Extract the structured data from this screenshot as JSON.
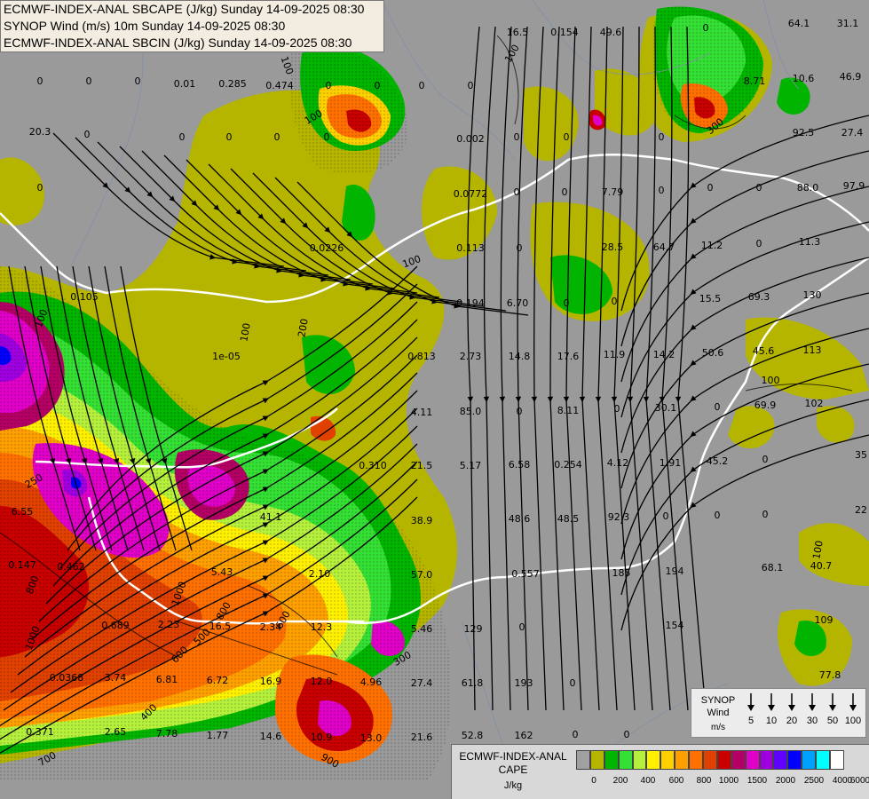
{
  "titles": {
    "line1": "ECMWF-INDEX-ANAL SBCAPE (J/kg) Sunday 14-09-2025 08:30",
    "line2": "SYNOP Wind (m/s) 10m Sunday 14-09-2025 08:30",
    "line3": "ECMWF-INDEX-ANAL SBCIN (J/kg) Sunday 14-09-2025 08:30"
  },
  "cape_legend": {
    "title_line1": "ECMWF-INDEX-ANAL",
    "title_line2": "CAPE",
    "unit": "J/kg",
    "tick_labels": [
      "0",
      "200",
      "400",
      "600",
      "800",
      "1000",
      "1500",
      "2000",
      "2500",
      "4000",
      "6000"
    ],
    "colors": [
      "#a0a0a0",
      "#b5b500",
      "#00b400",
      "#35e035",
      "#b4f03c",
      "#fff000",
      "#ffd000",
      "#ffa000",
      "#ff7000",
      "#e04000",
      "#c80000",
      "#b40064",
      "#e000c8",
      "#a000e0",
      "#6000ff",
      "#0000ff",
      "#00a0ff",
      "#00ffff",
      "#ffffff"
    ]
  },
  "wind_legend": {
    "title_line1": "SYNOP",
    "title_line2": "Wind",
    "unit": "m/s",
    "speeds": [
      "5",
      "10",
      "20",
      "30",
      "50",
      "100"
    ]
  },
  "map_labels": [
    {
      "text": "0"
    },
    {
      "text": "0"
    },
    {
      "text": "0"
    },
    {
      "text": "0.01"
    },
    {
      "text": "0.285"
    },
    {
      "text": "0.474"
    },
    {
      "text": "0"
    },
    {
      "text": "0"
    },
    {
      "text": "0"
    },
    {
      "text": "0"
    },
    {
      "text": "16.5"
    },
    {
      "text": "0.154"
    },
    {
      "text": "49.6"
    },
    {
      "text": "0"
    },
    {
      "text": "64.1"
    },
    {
      "text": "31.1"
    },
    {
      "text": "20.3"
    },
    {
      "text": "0"
    },
    {
      "text": "0"
    },
    {
      "text": "0"
    },
    {
      "text": "0"
    },
    {
      "text": "0"
    },
    {
      "text": "0.002"
    },
    {
      "text": "0"
    },
    {
      "text": "0"
    },
    {
      "text": "0"
    },
    {
      "text": "8.71"
    },
    {
      "text": "10.6"
    },
    {
      "text": "46.9"
    },
    {
      "text": "92.5"
    },
    {
      "text": "27.4"
    },
    {
      "text": "0"
    },
    {
      "text": "0.0772"
    },
    {
      "text": "0"
    },
    {
      "text": "0"
    },
    {
      "text": "7.79"
    },
    {
      "text": "0"
    },
    {
      "text": "0"
    },
    {
      "text": "0"
    },
    {
      "text": "88.0"
    },
    {
      "text": "97.9"
    },
    {
      "text": "0.0226"
    },
    {
      "text": "0.113"
    },
    {
      "text": "0"
    },
    {
      "text": "28.5"
    },
    {
      "text": "64.7"
    },
    {
      "text": "11.2"
    },
    {
      "text": "0"
    },
    {
      "text": "11.3"
    },
    {
      "text": "0.105"
    },
    {
      "text": "0.194"
    },
    {
      "text": "6.70"
    },
    {
      "text": "0"
    },
    {
      "text": "0"
    },
    {
      "text": "15.5"
    },
    {
      "text": "69.3"
    },
    {
      "text": "130"
    },
    {
      "text": "1e-05"
    },
    {
      "text": "0.813"
    },
    {
      "text": "2.73"
    },
    {
      "text": "14.8"
    },
    {
      "text": "17.6"
    },
    {
      "text": "11.9"
    },
    {
      "text": "14.2"
    },
    {
      "text": "50.6"
    },
    {
      "text": "45.6"
    },
    {
      "text": "113"
    },
    {
      "text": "4.11"
    },
    {
      "text": "85.0"
    },
    {
      "text": "0"
    },
    {
      "text": "8.11"
    },
    {
      "text": "0"
    },
    {
      "text": "30.1"
    },
    {
      "text": "0"
    },
    {
      "text": "69.9"
    },
    {
      "text": "102"
    },
    {
      "text": "0.310"
    },
    {
      "text": "21.5"
    },
    {
      "text": "5.17"
    },
    {
      "text": "6.58"
    },
    {
      "text": "0.254"
    },
    {
      "text": "4.12"
    },
    {
      "text": "1.91"
    },
    {
      "text": "45.2"
    },
    {
      "text": "0"
    },
    {
      "text": "35"
    },
    {
      "text": "6.55"
    },
    {
      "text": "41.1"
    },
    {
      "text": "38.9"
    },
    {
      "text": "48.6"
    },
    {
      "text": "48.5"
    },
    {
      "text": "92.3"
    },
    {
      "text": "0"
    },
    {
      "text": "0"
    },
    {
      "text": "0"
    },
    {
      "text": "22"
    },
    {
      "text": "0.147"
    },
    {
      "text": "0.462"
    },
    {
      "text": "5.43"
    },
    {
      "text": "2.10"
    },
    {
      "text": "57.0"
    },
    {
      "text": "0.557"
    },
    {
      "text": "185"
    },
    {
      "text": "194"
    },
    {
      "text": "68.1"
    },
    {
      "text": "40.7"
    },
    {
      "text": "0.689"
    },
    {
      "text": "2.23"
    },
    {
      "text": "16.5"
    },
    {
      "text": "2.34"
    },
    {
      "text": "12.3"
    },
    {
      "text": "5.46"
    },
    {
      "text": "129"
    },
    {
      "text": "0"
    },
    {
      "text": "154"
    },
    {
      "text": "109"
    },
    {
      "text": "0.0368"
    },
    {
      "text": "3.74"
    },
    {
      "text": "6.81"
    },
    {
      "text": "6.72"
    },
    {
      "text": "16.9"
    },
    {
      "text": "12.0"
    },
    {
      "text": "4.96"
    },
    {
      "text": "27.4"
    },
    {
      "text": "61.8"
    },
    {
      "text": "193"
    },
    {
      "text": "0"
    },
    {
      "text": "77.8"
    },
    {
      "text": "0.371"
    },
    {
      "text": "2.65"
    },
    {
      "text": "7.78"
    },
    {
      "text": "1.77"
    },
    {
      "text": "14.6"
    },
    {
      "text": "10.9"
    },
    {
      "text": "13.0"
    },
    {
      "text": "21.6"
    },
    {
      "text": "52.8"
    },
    {
      "text": "162"
    },
    {
      "text": "0"
    },
    {
      "text": "0"
    }
  ],
  "contour_labels": [
    {
      "text": "100"
    },
    {
      "text": "100"
    },
    {
      "text": "100"
    },
    {
      "text": "300"
    },
    {
      "text": "100"
    },
    {
      "text": "200"
    },
    {
      "text": "100"
    },
    {
      "text": "100"
    },
    {
      "text": "100"
    },
    {
      "text": "100"
    },
    {
      "text": "250"
    },
    {
      "text": "800"
    },
    {
      "text": "1000"
    },
    {
      "text": "1000"
    },
    {
      "text": "800"
    },
    {
      "text": "600"
    },
    {
      "text": "500"
    },
    {
      "text": "600"
    },
    {
      "text": "400"
    },
    {
      "text": "700"
    },
    {
      "text": "900"
    },
    {
      "text": "300"
    }
  ]
}
